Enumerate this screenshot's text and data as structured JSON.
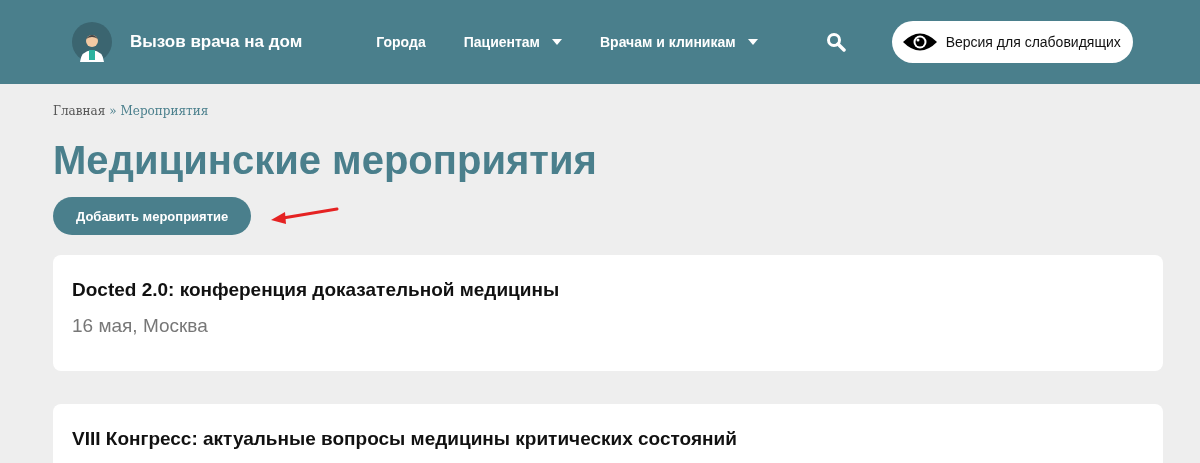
{
  "header": {
    "site_title": "Вызов врача на дом",
    "nav": [
      {
        "label": "Города",
        "kind": "link"
      },
      {
        "label": "Пациентам",
        "kind": "dropdown"
      },
      {
        "label": "Врачам и клиникам",
        "kind": "dropdown"
      }
    ],
    "accessibility_button": "Версия для слабовидящих"
  },
  "breadcrumb": [
    {
      "label": "Главная",
      "kind": "link"
    },
    {
      "label": "»",
      "kind": "separator"
    },
    {
      "label": "Мероприятия",
      "kind": "current"
    }
  ],
  "page_title": "Медицинские мероприятия",
  "add_button": "Добавить мероприятие",
  "events": [
    {
      "title": "Docted 2.0: конференция доказательной медицины",
      "meta": "16 мая, Москва"
    },
    {
      "title": "VIII Конгресс: актуальные вопросы медицины критических состояний"
    }
  ]
}
